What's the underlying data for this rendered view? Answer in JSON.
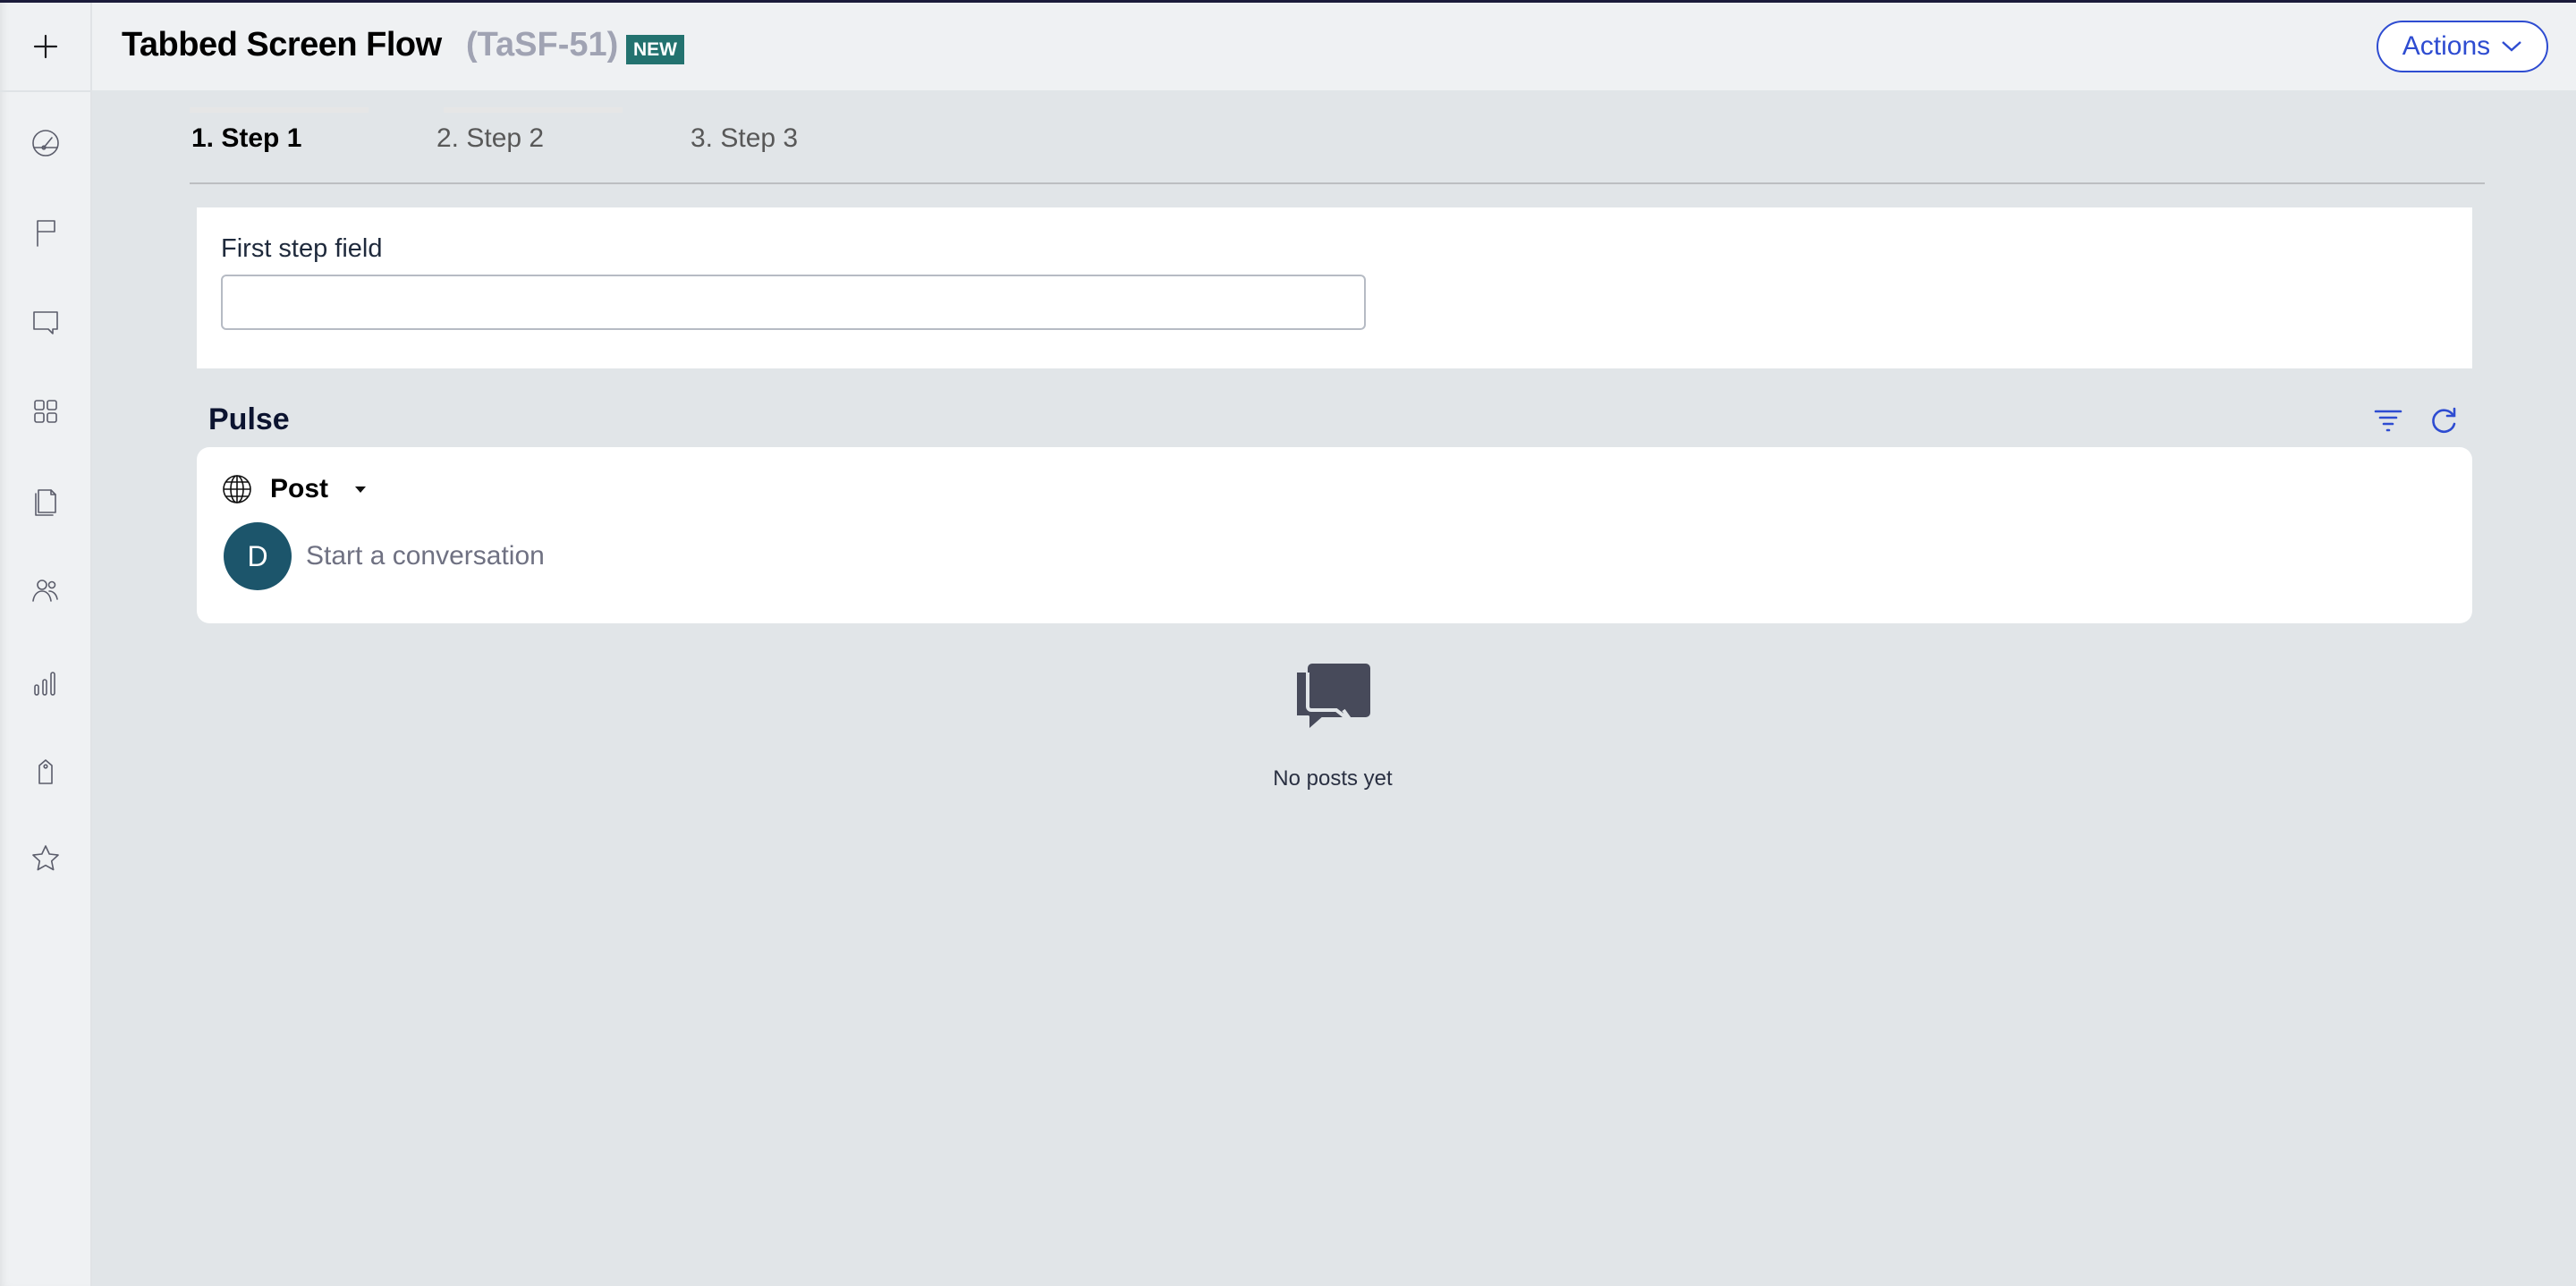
{
  "header": {
    "title": "Tabbed Screen Flow",
    "case_id": "(TaSF-51)",
    "status_badge": "NEW",
    "actions_label": "Actions"
  },
  "sidebar": {
    "items": [
      {
        "icon": "plus-icon",
        "label": "Create"
      },
      {
        "icon": "dashboard-icon",
        "label": "Dashboard"
      },
      {
        "icon": "flag-icon",
        "label": "Flag"
      },
      {
        "icon": "chat-icon",
        "label": "Messages"
      },
      {
        "icon": "apps-grid-icon",
        "label": "Apps"
      },
      {
        "icon": "documents-icon",
        "label": "Documents"
      },
      {
        "icon": "users-icon",
        "label": "Users"
      },
      {
        "icon": "reports-icon",
        "label": "Reports"
      },
      {
        "icon": "tag-icon",
        "label": "Tags"
      },
      {
        "icon": "star-icon",
        "label": "Favorites"
      }
    ]
  },
  "tabs": [
    {
      "label": "1. Step 1",
      "active": true
    },
    {
      "label": "2. Step 2",
      "active": false
    },
    {
      "label": "3. Step 3",
      "active": false
    }
  ],
  "form": {
    "field_label": "First step field",
    "field_value": ""
  },
  "pulse": {
    "title": "Pulse",
    "post_type": "Post",
    "avatar_initial": "D",
    "placeholder": "Start a conversation",
    "empty_text": "No posts yet"
  },
  "colors": {
    "accent": "#2e4cd1",
    "badge": "#23726f",
    "avatar": "#1c556b"
  }
}
